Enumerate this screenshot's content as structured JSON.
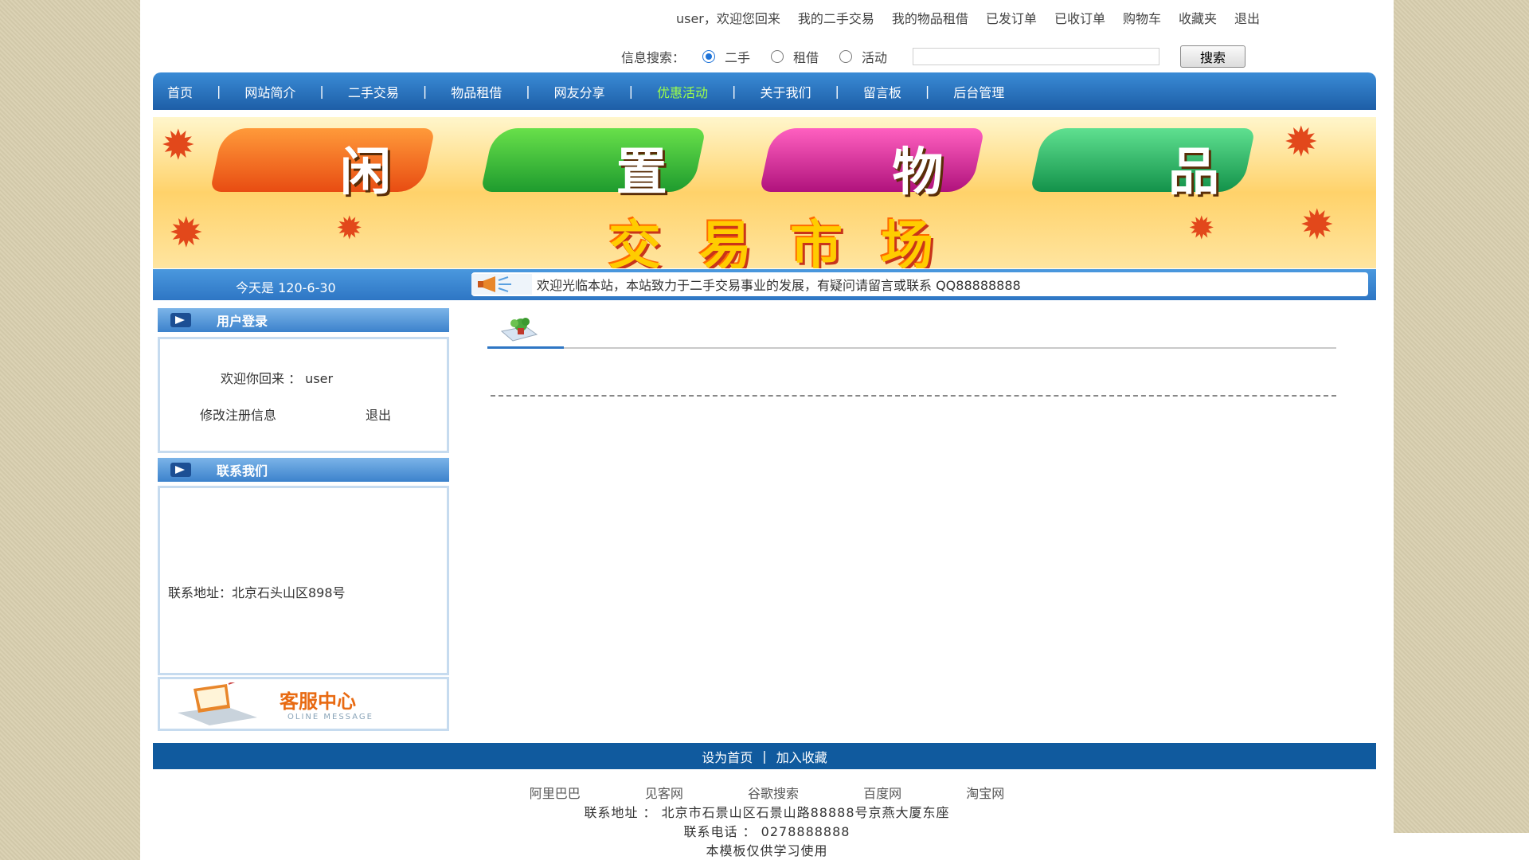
{
  "top_links": {
    "welcome": "user，欢迎您回来",
    "items": [
      "我的二手交易",
      "我的物品租借",
      "已发订单",
      "已收订单",
      "购物车",
      "收藏夹",
      "退出"
    ]
  },
  "search": {
    "label": "信息搜索：",
    "options": [
      {
        "label": "二手",
        "checked": true
      },
      {
        "label": "租借",
        "checked": false
      },
      {
        "label": "活动",
        "checked": false
      }
    ],
    "query": "",
    "button": "搜索"
  },
  "nav": {
    "items": [
      "首页",
      "网站简介",
      "二手交易",
      "物品租借",
      "网友分享",
      "优惠活动",
      "关于我们",
      "留言板",
      "后台管理"
    ],
    "active": "优惠活动",
    "separator": "|"
  },
  "banner": {
    "line1": [
      "闲",
      "置",
      "物",
      "品"
    ],
    "line2": "交易市场"
  },
  "info_bar": {
    "date": "今天是 120-6-30",
    "notice": "欢迎光临本站，本站致力于二手交易事业的发展，有疑问请留言或联系 QQ88888888"
  },
  "sidebar": {
    "login": {
      "title": "用户登录",
      "welcome_label": "欢迎你回来 ： user",
      "edit_link": "修改注册信息",
      "logout_link": "退出"
    },
    "contact": {
      "title": "联系我们",
      "address": "联系地址：北京石头山区898号"
    },
    "service": {
      "title": "客服中心",
      "subtitle": "OLINE MESSAGE"
    }
  },
  "footer": {
    "bar": [
      "设为首页",
      "加入收藏"
    ],
    "links": [
      "阿里巴巴",
      "见客网",
      "谷歌搜索",
      "百度网",
      "淘宝网"
    ],
    "address": "联系地址 ： 北京市石景山区石景山路88888号京燕大厦东座",
    "phone": "联系电话 ： 0278888888",
    "note": "本模板仅供学习使用"
  },
  "colors": {
    "nav_blue": "#2e76c4",
    "nav_active": "#9dff4a",
    "footer_blue": "#105a9e",
    "service_orange": "#e86a12"
  }
}
